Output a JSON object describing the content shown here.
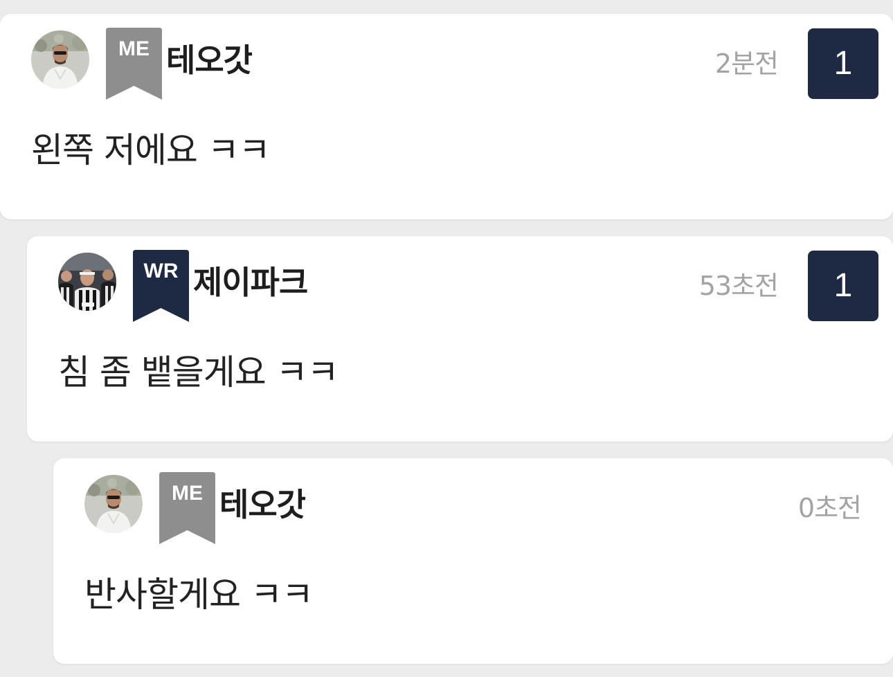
{
  "colors": {
    "background": "#ececec",
    "card": "#ffffff",
    "badge_me": "#8e8e8e",
    "badge_wr": "#1e2a44",
    "count_box": "#1e2a44",
    "time_text": "#a3a3a3"
  },
  "comments": [
    {
      "avatar": "profile-photo-man-sunglasses",
      "badge": "ME",
      "nickname": "테오갓",
      "time": "2분전",
      "count": "1",
      "text": "왼쪽 저에요 ㅋㅋ"
    },
    {
      "avatar": "profile-photo-soccer-players",
      "badge": "WR",
      "nickname": "제이파크",
      "time": "53초전",
      "count": "1",
      "text": "침 좀 뱉을게요 ㅋㅋ"
    },
    {
      "avatar": "profile-photo-man-sunglasses",
      "badge": "ME",
      "nickname": "테오갓",
      "time": "0초전",
      "text": "반사할게요 ㅋㅋ"
    }
  ]
}
